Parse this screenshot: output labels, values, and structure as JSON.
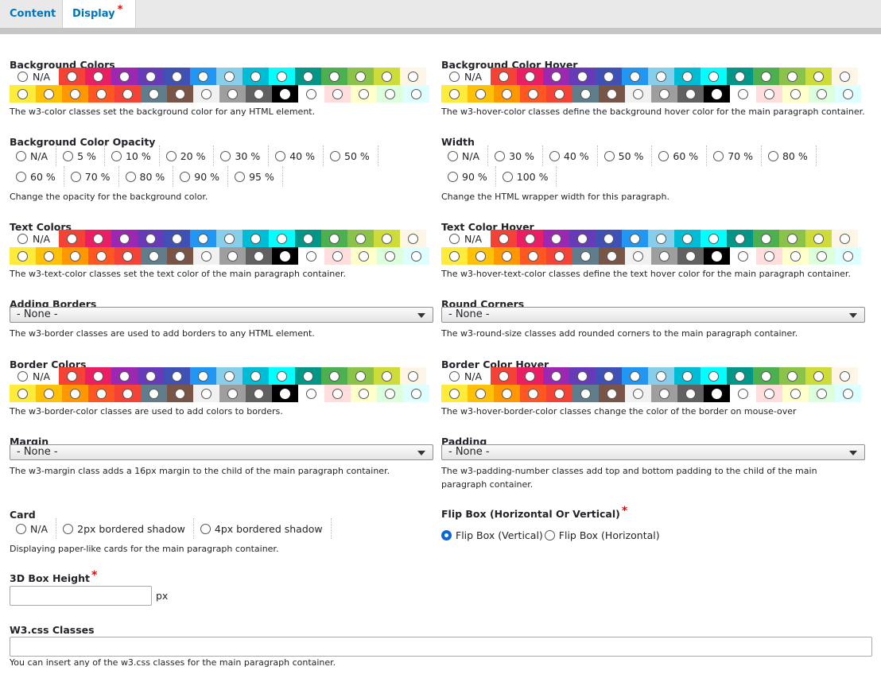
{
  "tabs": {
    "content": "Content",
    "display": "Display",
    "required_mark": "*"
  },
  "colors": {
    "row1": [
      "#f44336",
      "#e91e63",
      "#9c27b0",
      "#673ab7",
      "#3f51b5",
      "#2196f3",
      "#87ceeb",
      "#00bcd4",
      "#00ffff",
      "#009688",
      "#4caf50",
      "#8bc34a",
      "#cddc39",
      "#fdf5e6"
    ],
    "row2": [
      "#ffeb3b",
      "#ffc107",
      "#ff9800",
      "#ff5722",
      "#f44336",
      "#607d8b",
      "#795548",
      "#f1f1f1",
      "#9e9e9e",
      "#616161",
      "#000000",
      "#ffffff",
      "#ffdddd",
      "#ffffcc",
      "#ddffdd",
      "#ddffff"
    ]
  },
  "left": {
    "bg_colors": {
      "label": "Background Colors",
      "na": "N/A",
      "desc": "The w3-color classes set the background color for any HTML element."
    },
    "bg_opacity": {
      "label": "Background Color Opacity",
      "options": [
        "N/A",
        "5 %",
        "10 %",
        "20 %",
        "30 %",
        "40 %",
        "50 %",
        "60 %",
        "70 %",
        "80 %",
        "90 %",
        "95 %"
      ],
      "desc": "Change the opacity for the background color."
    },
    "text_colors": {
      "label": "Text Colors",
      "na": "N/A",
      "desc": "The w3-text-color classes set the text color of the main paragraph container."
    },
    "borders": {
      "label": "Adding Borders",
      "value": "- None -",
      "desc": "The w3-border classes are used to add borders to any HTML element."
    },
    "border_colors": {
      "label": "Border Colors",
      "na": "N/A",
      "desc": "The w3-border-color classes are used to add colors to borders."
    },
    "margin": {
      "label": "Margin",
      "value": "- None -",
      "desc": "The w3-margin class adds a 16px margin to the child of the main paragraph container."
    },
    "card": {
      "label": "Card",
      "options": [
        "N/A",
        "2px bordered shadow",
        "4px bordered shadow"
      ],
      "desc": "Displaying paper-like cards for the main paragraph container."
    },
    "box_height": {
      "label": "3D Box Height",
      "required_mark": "*",
      "value": "",
      "unit": "px"
    }
  },
  "right": {
    "bg_hover": {
      "label": "Background Color Hover",
      "na": "N/A",
      "desc": "The w3-hover-color classes define the background hover color for the main paragraph container."
    },
    "width": {
      "label": "Width",
      "options": [
        "N/A",
        "30 %",
        "40 %",
        "50 %",
        "60 %",
        "70 %",
        "80 %",
        "90 %",
        "100 %"
      ],
      "desc": "Change the HTML wrapper width for this paragraph."
    },
    "text_hover": {
      "label": "Text Color Hover",
      "na": "N/A",
      "desc": "The w3-hover-text-color classes define the text hover color for the main paragraph container."
    },
    "round": {
      "label": "Round Corners",
      "value": "- None -",
      "desc": "The w3-round-size classes add rounded corners to the main paragraph container."
    },
    "border_hover": {
      "label": "Border Color Hover",
      "na": "N/A",
      "desc": "The w3-hover-border-color classes change the color of the border on mouse-over"
    },
    "padding": {
      "label": "Padding",
      "value": "- None -",
      "desc1": "The w3-padding-number classes add top and bottom padding to the child of the main",
      "desc2": "paragraph container."
    },
    "flip": {
      "label": "Flip Box (Horizontal Or Vertical)",
      "required_mark": "*",
      "options": [
        "Flip Box (Vertical)",
        "Flip Box (Horizontal)"
      ],
      "selected": 0
    }
  },
  "w3css": {
    "label": "W3.css Classes",
    "value": "",
    "desc": "You can insert any of the w3.css classes for the main paragraph container."
  }
}
